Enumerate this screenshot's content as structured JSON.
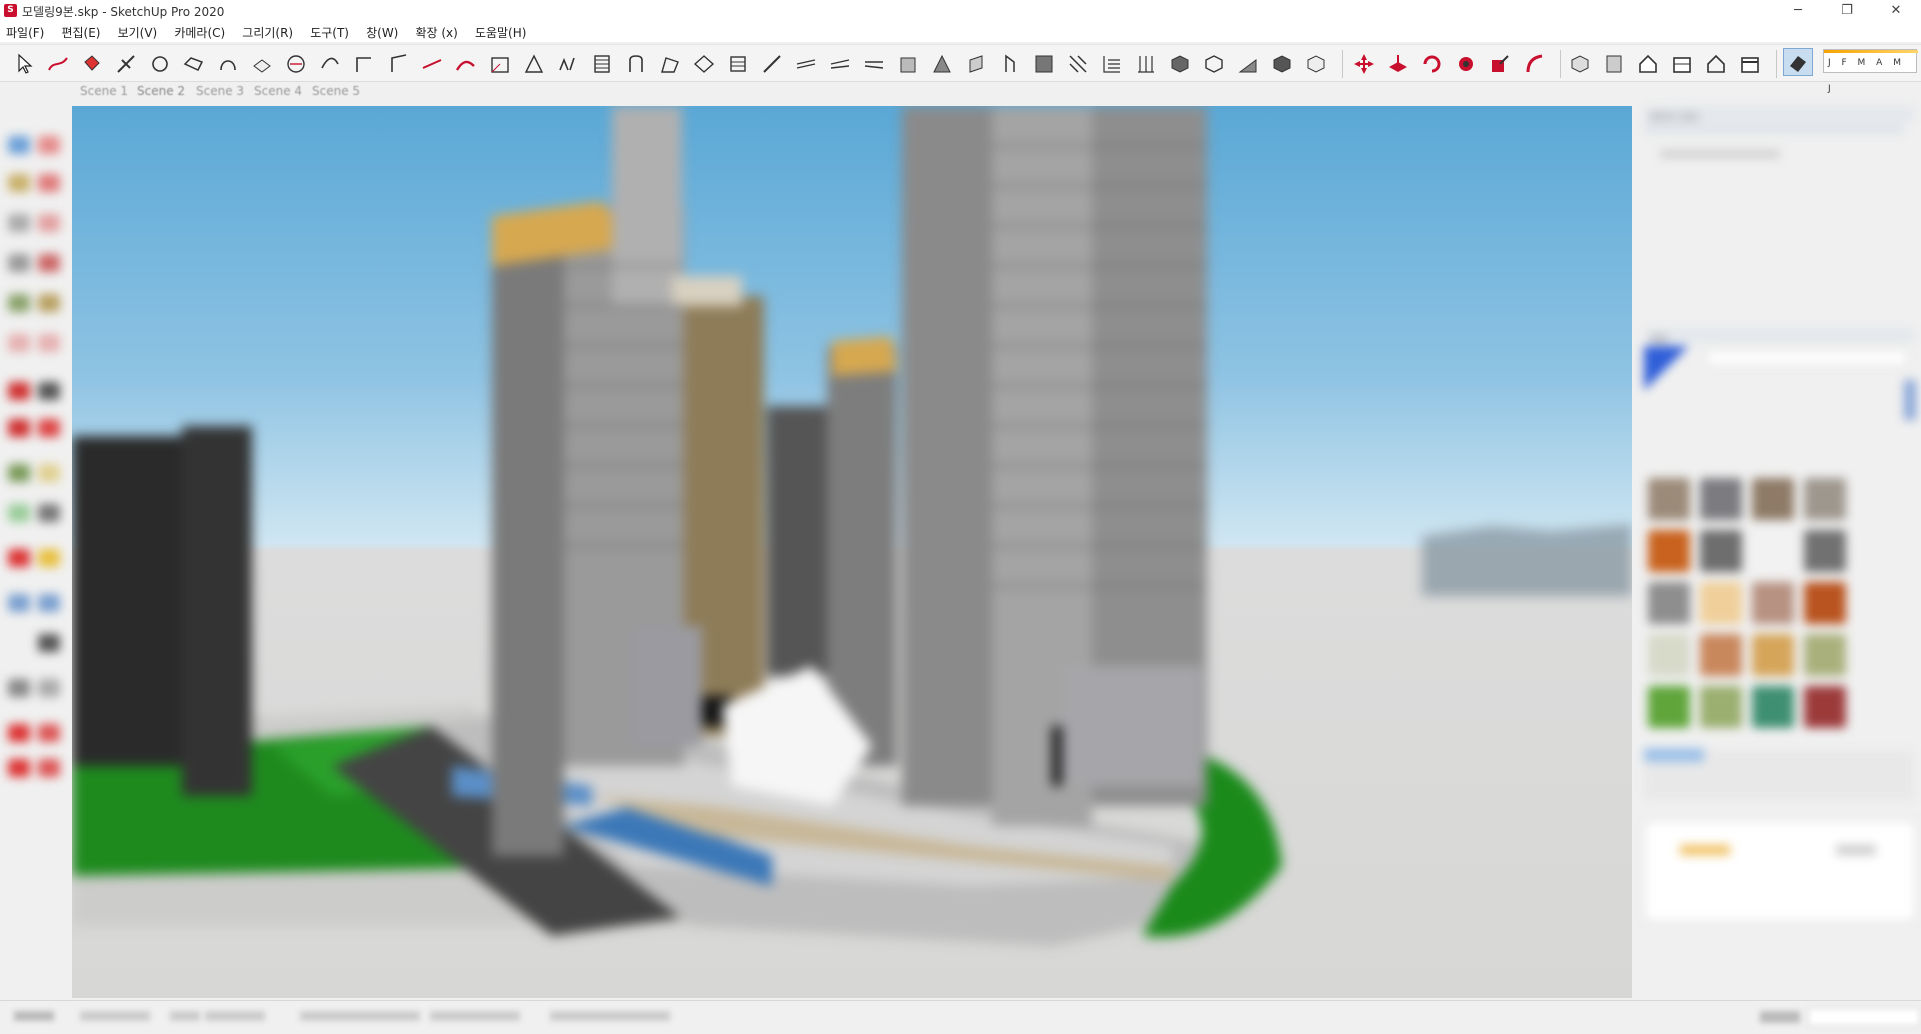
{
  "window": {
    "title": "모델링9본.skp - SketchUp Pro 2020",
    "app_icon": "S",
    "minimize": "─",
    "restore": "❐",
    "close": "✕"
  },
  "menu": [
    {
      "label": "파일(F)"
    },
    {
      "label": "편집(E)"
    },
    {
      "label": "보기(V)"
    },
    {
      "label": "카메라(C)"
    },
    {
      "label": "그리기(R)"
    },
    {
      "label": "도구(T)"
    },
    {
      "label": "창(W)"
    },
    {
      "label": "확장 (x)"
    },
    {
      "label": "도움말(H)"
    }
  ],
  "toolbar": {
    "shadow_months": "J F M A M J"
  },
  "scenes": [
    {
      "label": "Scene 1"
    },
    {
      "label": "Scene 2"
    },
    {
      "label": "Scene 3"
    },
    {
      "label": "Scene 4"
    },
    {
      "label": "Scene 5"
    }
  ],
  "colors": {
    "accent_red": "#c8102e",
    "sky": "#5aa8d6",
    "ground": "#d7d7d5",
    "grass": "#1e8a1e"
  },
  "materials": {
    "swatches": [
      "#9b8a78",
      "#7c7c80",
      "#8e7a66",
      "#9e978e",
      "#c8621e",
      "#6e6e6e",
      "#f2f2f2",
      "#717171",
      "#8e8e8e",
      "#f0cf9a",
      "#b79181",
      "#b9531f",
      "#d7d9c9",
      "#c9875c",
      "#d5a55a",
      "#aab07c",
      "#5fa53a",
      "#9aaf70",
      "#3f8f72",
      "#9c3a3a"
    ]
  },
  "tray": {
    "entity_info_title": "엔티티 정보",
    "materials_title": "재료"
  }
}
